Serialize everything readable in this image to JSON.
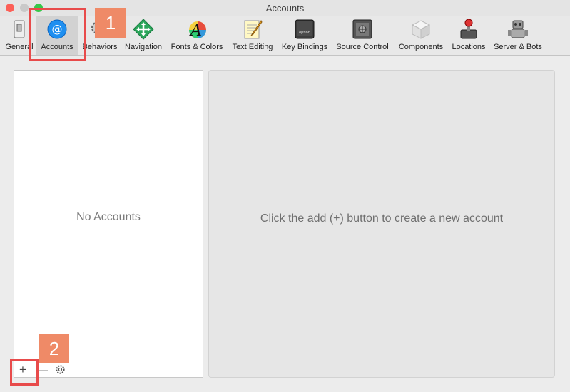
{
  "window": {
    "title": "Accounts"
  },
  "toolbar": {
    "items": [
      {
        "label": "General"
      },
      {
        "label": "Accounts"
      },
      {
        "label": "Behaviors"
      },
      {
        "label": "Navigation"
      },
      {
        "label": "Fonts & Colors"
      },
      {
        "label": "Text Editing"
      },
      {
        "label": "Key Bindings"
      },
      {
        "label": "Source Control"
      },
      {
        "label": "Components"
      },
      {
        "label": "Locations"
      },
      {
        "label": "Server & Bots"
      }
    ],
    "selected": "Accounts",
    "key_icon_text": "option"
  },
  "accounts_list": {
    "empty_text": "No Accounts"
  },
  "detail": {
    "empty_text": "Click the add (+) button to create a new account"
  },
  "bottom_bar": {
    "add_label": "+",
    "remove_label": "—"
  },
  "annotations": {
    "callout1": "1",
    "callout2": "2"
  },
  "colors": {
    "accent": "#e84b4b",
    "callout_fill": "#ef8a67",
    "selected_bg": "#d2d2d2"
  }
}
